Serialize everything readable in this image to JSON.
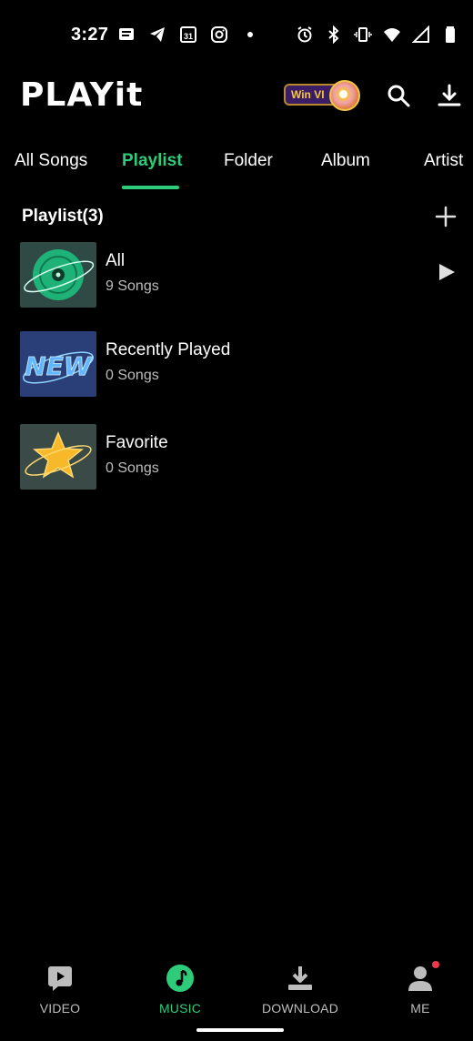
{
  "status_bar": {
    "time": "3:27",
    "left_icons": [
      "message-icon",
      "telegram-icon",
      "calendar-icon",
      "instagram-icon",
      "dot-icon"
    ],
    "calendar_day": "31",
    "right_icons": [
      "alarm-icon",
      "bluetooth-icon",
      "vibrate-icon",
      "wifi-icon",
      "signal-icon",
      "battery-icon"
    ]
  },
  "header": {
    "logo": "PLAYit",
    "vip_label": "Win VI",
    "icons": [
      "search-icon",
      "download-icon"
    ]
  },
  "tabs": [
    {
      "label": "All Songs",
      "active": false
    },
    {
      "label": "Playlist",
      "active": true
    },
    {
      "label": "Folder",
      "active": false
    },
    {
      "label": "Album",
      "active": false
    },
    {
      "label": "Artist",
      "active": false
    }
  ],
  "section": {
    "title": "Playlist(3)"
  },
  "playlists": [
    {
      "title": "All",
      "subtitle": "9 Songs",
      "thumb_label": ""
    },
    {
      "title": "Recently Played",
      "subtitle": "0 Songs",
      "thumb_label": "NEW"
    },
    {
      "title": "Favorite",
      "subtitle": "0 Songs",
      "thumb_label": ""
    }
  ],
  "bottom_nav": [
    {
      "label": "VIDEO",
      "active": false
    },
    {
      "label": "MUSIC",
      "active": true
    },
    {
      "label": "DOWNLOAD",
      "active": false
    },
    {
      "label": "ME",
      "active": false
    }
  ],
  "colors": {
    "accent": "#2ecc7a",
    "background": "#000000",
    "secondary_text": "#bdbdbd",
    "notification_dot": "#f0384b"
  }
}
